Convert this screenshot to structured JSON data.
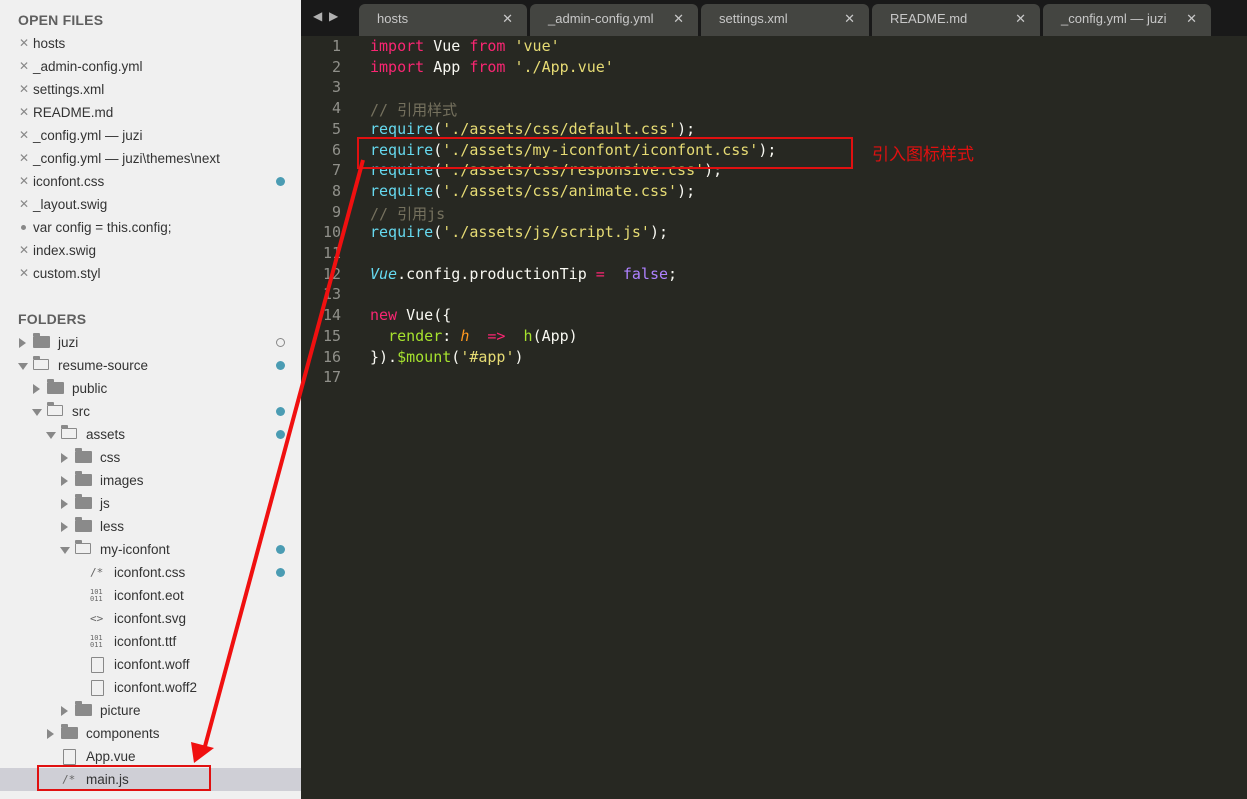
{
  "sidebar": {
    "open_files_header": "OPEN FILES",
    "open_files": [
      {
        "label": "hosts",
        "marker": "close",
        "dot": false
      },
      {
        "label": "_admin-config.yml",
        "marker": "close",
        "dot": false
      },
      {
        "label": "settings.xml",
        "marker": "close",
        "dot": false
      },
      {
        "label": "README.md",
        "marker": "close",
        "dot": false
      },
      {
        "label": "_config.yml — juzi",
        "marker": "close",
        "dot": false
      },
      {
        "label": "_config.yml — juzi\\themes\\next",
        "marker": "close",
        "dot": false
      },
      {
        "label": "iconfont.css",
        "marker": "close",
        "dot": true
      },
      {
        "label": "_layout.swig",
        "marker": "close",
        "dot": false
      },
      {
        "label": "var config = this.config;",
        "marker": "dirty",
        "dot": false
      },
      {
        "label": "index.swig",
        "marker": "close",
        "dot": false
      },
      {
        "label": "custom.styl",
        "marker": "close",
        "dot": false
      }
    ],
    "folders_header": "FOLDERS",
    "tree": [
      {
        "label": "juzi",
        "depth": 0,
        "kind": "folder",
        "open": false,
        "status": "ring"
      },
      {
        "label": "resume-source",
        "depth": 0,
        "kind": "folder",
        "open": true,
        "status": "dot"
      },
      {
        "label": "public",
        "depth": 1,
        "kind": "folder",
        "open": false,
        "status": ""
      },
      {
        "label": "src",
        "depth": 1,
        "kind": "folder",
        "open": true,
        "status": "dot"
      },
      {
        "label": "assets",
        "depth": 2,
        "kind": "folder",
        "open": true,
        "status": "dot"
      },
      {
        "label": "css",
        "depth": 3,
        "kind": "folder",
        "open": false,
        "status": ""
      },
      {
        "label": "images",
        "depth": 3,
        "kind": "folder",
        "open": false,
        "status": ""
      },
      {
        "label": "js",
        "depth": 3,
        "kind": "folder",
        "open": false,
        "status": ""
      },
      {
        "label": "less",
        "depth": 3,
        "kind": "folder",
        "open": false,
        "status": ""
      },
      {
        "label": "my-iconfont",
        "depth": 3,
        "kind": "folder",
        "open": true,
        "status": "dot"
      },
      {
        "label": "iconfont.css",
        "depth": 4,
        "kind": "comment-file",
        "icon": "/*",
        "status": "dot"
      },
      {
        "label": "iconfont.eot",
        "depth": 4,
        "kind": "binary-file",
        "icon": "101\n011",
        "status": ""
      },
      {
        "label": "iconfont.svg",
        "depth": 4,
        "kind": "markup-file",
        "icon": "<>",
        "status": ""
      },
      {
        "label": "iconfont.ttf",
        "depth": 4,
        "kind": "binary-file",
        "icon": "101\n011",
        "status": ""
      },
      {
        "label": "iconfont.woff",
        "depth": 4,
        "kind": "page-file",
        "icon": "",
        "status": ""
      },
      {
        "label": "iconfont.woff2",
        "depth": 4,
        "kind": "page-file",
        "icon": "",
        "status": ""
      },
      {
        "label": "picture",
        "depth": 3,
        "kind": "folder",
        "open": false,
        "status": ""
      },
      {
        "label": "components",
        "depth": 2,
        "kind": "folder",
        "open": false,
        "status": ""
      },
      {
        "label": "App.vue",
        "depth": 2,
        "kind": "page-file",
        "icon": "",
        "status": ""
      },
      {
        "label": "main.js",
        "depth": 2,
        "kind": "comment-file",
        "icon": "/*",
        "status": "",
        "selected": true
      }
    ]
  },
  "tabs": [
    {
      "label": "hosts",
      "close": "✕"
    },
    {
      "label": "_admin-config.yml",
      "close": "✕"
    },
    {
      "label": "settings.xml",
      "close": "✕"
    },
    {
      "label": "README.md",
      "close": "✕"
    },
    {
      "label": "_config.yml — juzi",
      "close": "✕"
    }
  ],
  "nav": {
    "back": "◀",
    "forward": "▶"
  },
  "editor": {
    "line_numbers": [
      "1",
      "2",
      "3",
      "4",
      "5",
      "6",
      "7",
      "8",
      "9",
      "10",
      "11",
      "12",
      "13",
      "14",
      "15",
      "16",
      "17"
    ],
    "lines": [
      [
        [
          "k",
          "import"
        ],
        [
          "",
          "Vue"
        ],
        [
          "k",
          "from"
        ],
        [
          "s",
          "'vue'"
        ]
      ],
      [
        [
          "k",
          "import"
        ],
        [
          "",
          "App"
        ],
        [
          "k",
          "from"
        ],
        [
          "s",
          "'./App.vue'"
        ]
      ],
      [],
      [
        [
          "cm",
          "// 引用样式"
        ]
      ],
      [
        [
          "f",
          "require"
        ],
        [
          "",
          "("
        ],
        [
          "s",
          "'./assets/css/default.css'"
        ],
        [
          "",
          ");"
        ]
      ],
      [
        [
          "f",
          "require"
        ],
        [
          "",
          "("
        ],
        [
          "s",
          "'./assets/my-iconfont/iconfont.css'"
        ],
        [
          "",
          ");"
        ]
      ],
      [
        [
          "f",
          "require"
        ],
        [
          "",
          "("
        ],
        [
          "s",
          "'./assets/css/responsive.css'"
        ],
        [
          "",
          ");"
        ]
      ],
      [
        [
          "f",
          "require"
        ],
        [
          "",
          "("
        ],
        [
          "s",
          "'./assets/css/animate.css'"
        ],
        [
          "",
          ");"
        ]
      ],
      [
        [
          "cm",
          "// 引用js"
        ]
      ],
      [
        [
          "f",
          "require"
        ],
        [
          "",
          "("
        ],
        [
          "s",
          "'./assets/js/script.js'"
        ],
        [
          "",
          ");"
        ]
      ],
      [],
      [
        [
          "it",
          "Vue"
        ],
        [
          "",
          ".config.productionTip "
        ],
        [
          "k",
          "="
        ],
        [
          "",
          ""
        ],
        [
          "pu",
          "false"
        ],
        [
          "",
          ";"
        ]
      ],
      [],
      [
        [
          "k",
          "new"
        ],
        [
          "",
          "Vue({"
        ]
      ],
      [
        [
          "",
          "  "
        ],
        [
          "gr",
          "render"
        ],
        [
          "",
          ": "
        ],
        [
          "or",
          "h"
        ],
        [
          "",
          ""
        ],
        [
          "k",
          "=>"
        ],
        [
          "",
          ""
        ],
        [
          "gr",
          "h"
        ],
        [
          "",
          "(App)"
        ]
      ],
      [
        [
          "",
          "})."
        ],
        [
          "gr",
          "$mount"
        ],
        [
          "",
          "("
        ],
        [
          "s",
          "'#app'"
        ],
        [
          "",
          ")"
        ]
      ],
      []
    ]
  },
  "annotation": "引入图标样式"
}
